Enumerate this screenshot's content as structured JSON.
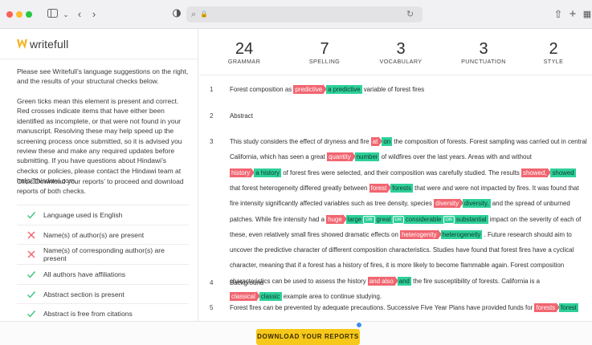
{
  "logo_text": "writefull",
  "left": {
    "para1": "Please see Writefull’s language suggestions on the right, and the results of your structural checks below.",
    "para2": "Green ticks mean this element is present and correct. Red crosses indicate items that have either been identified as incomplete, or that were not found in your manuscript. Resolving these may help speed up the screening process once submitted, so it is advised you review these and make any required updates before submitting. If you have questions about Hindawi’s checks or policies, please contact the Hindawi team at help@hindawi.com.",
    "para3": "Click ‘Download your reports’ to proceed and download reports of both checks.",
    "checks": [
      {
        "label": "Language used is English",
        "status": "pass"
      },
      {
        "label": "Name(s) of author(s) are present",
        "status": "fail"
      },
      {
        "label": "Name(s) of corresponding author(s) are present",
        "status": "fail"
      },
      {
        "label": "All authors have affiliations",
        "status": "pass"
      },
      {
        "label": "Abstract section is present",
        "status": "pass"
      },
      {
        "label": "Abstract is free from citations",
        "status": "pass"
      }
    ]
  },
  "stats": [
    {
      "count": "24",
      "label": "GRAMMAR"
    },
    {
      "count": "7",
      "label": "SPELLING"
    },
    {
      "count": "3",
      "label": "VOCABULARY"
    },
    {
      "count": "3",
      "label": "PUNCTUATION"
    },
    {
      "count": "2",
      "label": "STYLE"
    }
  ],
  "doc": {
    "n1": "1",
    "n2": "2",
    "n3": "3",
    "n4": "4",
    "n5": "5",
    "r1_a": "Forest composition as ",
    "r1_del": "predictive",
    "r1_ins": "a predictive",
    "r1_b": " variable of forest fires",
    "r2": "Abstract",
    "l1_a": "This study considers the effect of dryness and fire ",
    "l1_del": "at",
    "l1_ins": "on",
    "l1_b": " the composition of forests. Forest sampling was carried out in central",
    "l2_a": "California, which has seen a great ",
    "l2_del": "quantity",
    "l2_ins": "number",
    "l2_b": " of wildfires over the last years. Areas with and without",
    "l3_del": "history",
    "l3_ins": "a history",
    "l3_a": " of forest fires were selected, and their composition was carefully studied. The results ",
    "l3_del2": "showed,",
    "l3_ins2": "showed",
    "l4_a": "that forest heterogeneity differed greatly between ",
    "l4_del": "forest",
    "l4_ins": "forests",
    "l4_b": " that were and were not impacted by fires. It was found that",
    "l5_a": "fire intensity significantly affected variables such as tree density, species ",
    "l5_del": "diversity",
    "l5_ins": "diversity,",
    "l5_b": " and the spread of unburned",
    "l6_a": "patches. While fire intensity had a ",
    "l6_del": "huge",
    "l6_alt1": "large",
    "l6_or": "OR",
    "l6_alt2": "great",
    "l6_alt3": "considerable",
    "l6_alt4": "substantial",
    "l6_b": " impact on the severity of each of",
    "l7_a": "these, even relatively small fires showed dramatic effects on ",
    "l7_del": "heterogenity",
    "l7_ins": "heterogeneity",
    "l7_b": " . Future research should aim to",
    "l8": "uncover the predictive character of different composition characteristics. Studies have found that forest fires have a cyclical",
    "l9": "character, meaning that if a forest has a history of fires, it is more likely to become flammable again. Forest composition",
    "l10_a": "characteristics can be used to assess the history ",
    "l10_del": "and also",
    "l10_ins": "and",
    "l10_b": " the fire susceptibility of forests. California is a",
    "l11_del": "classical",
    "l11_ins": "classic",
    "l11_a": " example area to continue studying.",
    "r4": "Background",
    "r5_a": "Forest fires can be prevented by adequate precautions. Successive Five Year Plans have provided funds for ",
    "r5_del": "forests",
    "r5_ins": "forest"
  },
  "download_label": "DOWNLOAD YOUR REPORTS",
  "colors": {
    "accent": "#f6c81a",
    "pass": "#3cc47c",
    "fail": "#f0606a",
    "insert": "#2fd09a",
    "delete": "#f16570"
  }
}
